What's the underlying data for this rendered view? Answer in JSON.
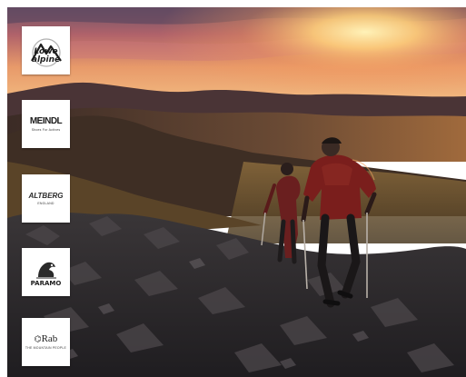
{
  "hero": {
    "scene": "two-hikers-sunset-ridge"
  },
  "brands": [
    {
      "key": "lowe-alpine",
      "name_line1": "Lowe",
      "name_line2": "alpine",
      "tagline": "",
      "icon": "lowe-alpine-logo-icon"
    },
    {
      "key": "meindl",
      "name": "MEINDL",
      "tagline": "Shoes For Actives",
      "icon": "meindl-logo-icon"
    },
    {
      "key": "altberg",
      "name": "ALTBERG",
      "tagline": "ENGLAND",
      "icon": "altberg-logo-icon"
    },
    {
      "key": "paramo",
      "name": "PARAMO",
      "tagline": "",
      "icon": "paramo-logo-icon"
    },
    {
      "key": "rab",
      "name": "Rab",
      "tagline": "THE MOUNTAIN PEOPLE",
      "icon": "rab-logo-icon"
    }
  ],
  "colors": {
    "sky_top": "#7a5a6e",
    "sun": "#ffd27a",
    "hills": "#3a2c2a",
    "rock": "#2e2b2c",
    "jacket": "#7a1e1c"
  }
}
